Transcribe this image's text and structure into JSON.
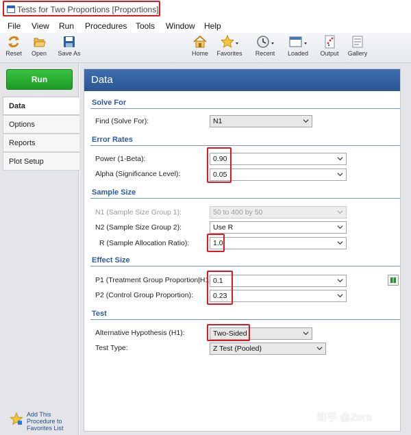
{
  "window": {
    "title": "Tests for Two Proportions [Proportions]"
  },
  "menu": [
    "File",
    "View",
    "Run",
    "Procedures",
    "Tools",
    "Window",
    "Help"
  ],
  "toolbar": {
    "reset": "Reset",
    "open": "Open",
    "save_as": "Save As",
    "home": "Home",
    "favorites": "Favorites",
    "recent": "Recent",
    "loaded": "Loaded",
    "output": "Output",
    "gallery": "Gallery"
  },
  "left": {
    "run": "Run",
    "tabs": [
      "Data",
      "Options",
      "Reports",
      "Plot Setup"
    ],
    "favorites_link": "Add This Procedure to Favorites List"
  },
  "panel": {
    "header": "Data"
  },
  "solve_for": {
    "title": "Solve For",
    "find_label": "Find (Solve For):",
    "find_value": "N1"
  },
  "error_rates": {
    "title": "Error Rates",
    "power_label": "Power (1-Beta):",
    "power_value": "0.90",
    "alpha_label": "Alpha (Significance Level):",
    "alpha_value": "0.05"
  },
  "sample_size": {
    "title": "Sample Size",
    "n1_label": "N1 (Sample Size Group 1):",
    "n1_value": "50 to 400 by 50",
    "n2_label": "N2 (Sample Size Group 2):",
    "n2_value": "Use R",
    "r_label": "R (Sample Allocation Ratio):",
    "r_value": "1.0"
  },
  "effect_size": {
    "title": "Effect Size",
    "p1_label": "P1 (Treatment Group Proportion|H1):",
    "p1_value": "0.1",
    "p2_label": "P2 (Control Group Proportion):",
    "p2_value": "0.23"
  },
  "test": {
    "title": "Test",
    "alt_label": "Alternative Hypothesis (H1):",
    "alt_value": "Two-Sided",
    "type_label": "Test Type:",
    "type_value": "Z Test (Pooled)"
  },
  "watermark": "知乎 @Zero",
  "colors": {
    "run_green": "#1d9a25",
    "header_blue": "#2a5593",
    "highlight_red": "#e0171f",
    "section_blue": "#2d5aa0"
  }
}
